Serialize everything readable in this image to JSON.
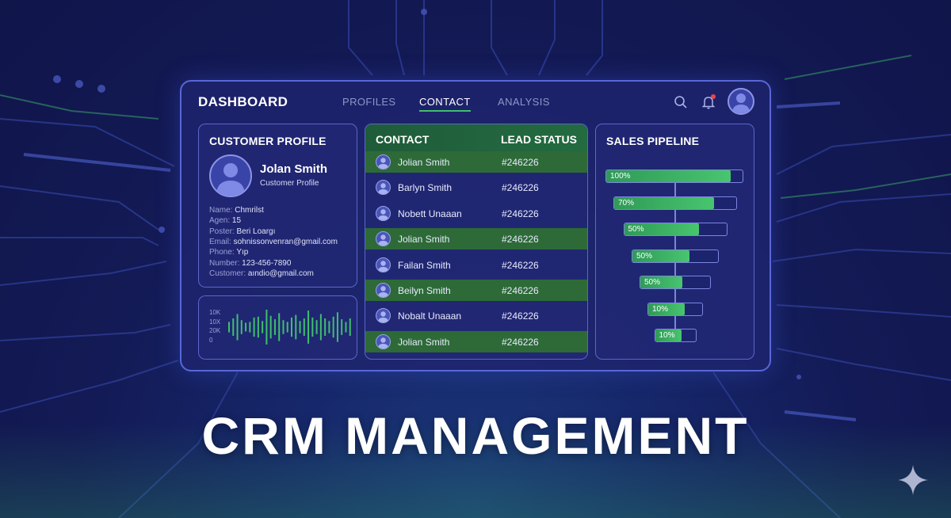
{
  "colors": {
    "background": "#131a55",
    "panel_border": "#5867d6",
    "accent_green": "#3fbf6d",
    "notification_dot": "#e5484d"
  },
  "header": {
    "title": "DASHBOARD",
    "tabs": [
      {
        "label": "PROFILES",
        "active": false
      },
      {
        "label": "CONTACT",
        "active": true
      },
      {
        "label": "ANALYSIS",
        "active": false
      }
    ],
    "icons": [
      "search-icon",
      "bell-icon",
      "user-avatar-icon"
    ]
  },
  "customer_profile": {
    "title": "CUSTOMER PROFILE",
    "name": "Jolan Smith",
    "subtitle": "Customer Profile",
    "details": [
      {
        "key": "Name:",
        "value": "Chmrilst"
      },
      {
        "key": "Agen:",
        "value": "15"
      },
      {
        "key": "Poster:",
        "value": "Beri Loargı"
      },
      {
        "key": "Email:",
        "value": "sohnissonvenran@gmail.com"
      },
      {
        "key": "Phone:",
        "value": "Yıp"
      },
      {
        "key": "Number:",
        "value": "123-456-7890"
      },
      {
        "key": "Customer:",
        "value": "aındio@gmail.com"
      }
    ]
  },
  "mini_chart": {
    "y_labels": [
      "10K",
      "10X",
      "20K",
      "0"
    ],
    "values": [
      0.3,
      0.5,
      0.75,
      0.4,
      0.25,
      0.3,
      0.55,
      0.6,
      0.35,
      1.0,
      0.65,
      0.45,
      0.8,
      0.4,
      0.3,
      0.55,
      0.7,
      0.35,
      0.5,
      0.95,
      0.55,
      0.4,
      0.75,
      0.5,
      0.35,
      0.6,
      0.85,
      0.45,
      0.3,
      0.5
    ]
  },
  "contact_table": {
    "columns": [
      "CONTACT",
      "LEAD STATUS"
    ],
    "rows": [
      {
        "name": "Jolian Smith",
        "id": "#246226",
        "highlight": true
      },
      {
        "name": "Barlyn Smith",
        "id": "#246226",
        "highlight": false
      },
      {
        "name": "Nobett Unaaan",
        "id": "#246226",
        "highlight": false
      },
      {
        "name": "Jolian Smith",
        "id": "#246226",
        "highlight": true
      },
      {
        "name": "Failan Smith",
        "id": "#246226",
        "highlight": false
      },
      {
        "name": "Beilyn Smith",
        "id": "#246226",
        "highlight": true
      },
      {
        "name": "Nobalt Unaaan",
        "id": "#246226",
        "highlight": false
      },
      {
        "name": "Jolian Smith",
        "id": "#246226",
        "highlight": true
      }
    ]
  },
  "sales_pipeline": {
    "title": "SALES PIPELINE",
    "stages": [
      {
        "label": "100%",
        "fill": 0.91
      },
      {
        "label": "70%",
        "fill": 0.82
      },
      {
        "label": "50%",
        "fill": 0.73
      },
      {
        "label": "50%",
        "fill": 0.67
      },
      {
        "label": "50%",
        "fill": 0.6
      },
      {
        "label": "10%",
        "fill": 0.68
      },
      {
        "label": "10%",
        "fill": 0.65
      }
    ]
  },
  "headline": "CRM MANAGEMENT"
}
